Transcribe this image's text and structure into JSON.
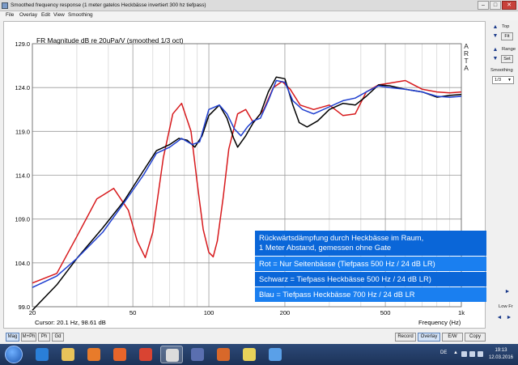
{
  "window": {
    "title": "Smoothed frequency response (1 meter gatelos Heckbässe invertiert 300 hz tiefpass)",
    "minimize": "–",
    "maximize": "□",
    "close": "✕"
  },
  "menu": [
    "File",
    "Overlay",
    "Edit",
    "View",
    "Smoothing"
  ],
  "chart_data": {
    "type": "line",
    "title": "FR Magnitude dB re 20uPa/V (smoothed 1/3 oct)",
    "xlabel": "Frequency (Hz)",
    "ylabel": "",
    "xscale": "log",
    "xlim": [
      20,
      1000
    ],
    "ylim": [
      99,
      129
    ],
    "x_ticks": [
      20,
      50,
      100,
      200,
      500,
      1000
    ],
    "x_tick_labels": [
      "20",
      "50",
      "100",
      "200",
      "500",
      "1k"
    ],
    "y_ticks": [
      99,
      104,
      109,
      114,
      119,
      124,
      129
    ],
    "y_tick_labels": [
      "99.0",
      "104.0",
      "109.0",
      "114.0",
      "119.0",
      "124.0",
      "129.0"
    ],
    "grid": true,
    "cursor_text": "Cursor: 20.1 Hz, 98.61 dB",
    "watermark": [
      "A",
      "R",
      "T",
      "A"
    ],
    "series": [
      {
        "color": "#d7191c",
        "points": [
          [
            20,
            101.7
          ],
          [
            25,
            102.8
          ],
          [
            30,
            107.0
          ],
          [
            36,
            111.3
          ],
          [
            42,
            112.5
          ],
          [
            48,
            110.0
          ],
          [
            52,
            106.5
          ],
          [
            56,
            104.6
          ],
          [
            60,
            107.5
          ],
          [
            66,
            116.0
          ],
          [
            72,
            121.0
          ],
          [
            78,
            122.2
          ],
          [
            85,
            119.0
          ],
          [
            90,
            113.0
          ],
          [
            95,
            107.8
          ],
          [
            100,
            105.2
          ],
          [
            104,
            104.7
          ],
          [
            108,
            106.5
          ],
          [
            114,
            111.5
          ],
          [
            120,
            117.0
          ],
          [
            130,
            121.0
          ],
          [
            140,
            121.5
          ],
          [
            150,
            120.0
          ],
          [
            165,
            121.5
          ],
          [
            180,
            124.0
          ],
          [
            195,
            124.7
          ],
          [
            210,
            123.8
          ],
          [
            230,
            122.0
          ],
          [
            260,
            121.5
          ],
          [
            300,
            122.0
          ],
          [
            340,
            120.8
          ],
          [
            380,
            121.0
          ],
          [
            420,
            123.5
          ],
          [
            470,
            124.3
          ],
          [
            520,
            124.5
          ],
          [
            600,
            124.8
          ],
          [
            700,
            123.8
          ],
          [
            800,
            123.5
          ],
          [
            900,
            123.4
          ],
          [
            1000,
            123.5
          ]
        ]
      },
      {
        "color": "#000000",
        "points": [
          [
            20,
            98.6
          ],
          [
            25,
            101.5
          ],
          [
            30,
            104.5
          ],
          [
            38,
            108.0
          ],
          [
            46,
            111.0
          ],
          [
            55,
            114.5
          ],
          [
            62,
            116.8
          ],
          [
            70,
            117.5
          ],
          [
            76,
            118.2
          ],
          [
            82,
            118.0
          ],
          [
            88,
            117.2
          ],
          [
            94,
            118.5
          ],
          [
            100,
            120.8
          ],
          [
            110,
            122.0
          ],
          [
            118,
            120.5
          ],
          [
            125,
            118.3
          ],
          [
            130,
            117.2
          ],
          [
            140,
            118.5
          ],
          [
            150,
            120.0
          ],
          [
            160,
            121.0
          ],
          [
            172,
            123.5
          ],
          [
            185,
            125.2
          ],
          [
            200,
            125.0
          ],
          [
            215,
            122.0
          ],
          [
            228,
            120.0
          ],
          [
            245,
            119.5
          ],
          [
            270,
            120.2
          ],
          [
            300,
            121.5
          ],
          [
            340,
            122.2
          ],
          [
            380,
            122.0
          ],
          [
            420,
            123.0
          ],
          [
            470,
            124.3
          ],
          [
            520,
            124.2
          ],
          [
            600,
            123.8
          ],
          [
            700,
            123.5
          ],
          [
            800,
            122.9
          ],
          [
            900,
            123.1
          ],
          [
            1000,
            123.2
          ]
        ]
      },
      {
        "color": "#1f3fd0",
        "points": [
          [
            20,
            101.2
          ],
          [
            25,
            102.5
          ],
          [
            30,
            104.5
          ],
          [
            38,
            107.5
          ],
          [
            46,
            110.8
          ],
          [
            55,
            114.0
          ],
          [
            62,
            116.5
          ],
          [
            70,
            117.2
          ],
          [
            78,
            118.2
          ],
          [
            86,
            117.5
          ],
          [
            92,
            117.8
          ],
          [
            100,
            121.5
          ],
          [
            110,
            122.0
          ],
          [
            118,
            121.0
          ],
          [
            126,
            119.3
          ],
          [
            134,
            118.5
          ],
          [
            142,
            119.5
          ],
          [
            150,
            120.2
          ],
          [
            160,
            120.5
          ],
          [
            172,
            122.5
          ],
          [
            185,
            124.8
          ],
          [
            200,
            124.6
          ],
          [
            215,
            122.5
          ],
          [
            235,
            121.5
          ],
          [
            260,
            121.0
          ],
          [
            300,
            121.8
          ],
          [
            340,
            122.5
          ],
          [
            380,
            122.8
          ],
          [
            420,
            123.5
          ],
          [
            470,
            124.2
          ],
          [
            520,
            124.0
          ],
          [
            600,
            123.8
          ],
          [
            700,
            123.5
          ],
          [
            800,
            123.0
          ],
          [
            900,
            122.9
          ],
          [
            1000,
            123.0
          ]
        ]
      }
    ],
    "legend_lines": [
      {
        "text": "Rückwärtsdämpfung durch Heckbässe im Raum,",
        "color": "#0a66d8"
      },
      {
        "text": "1 Meter Abstand, gemessen ohne Gate",
        "color": "#0a66d8"
      },
      {
        "text": "Rot = Nur Seitenbässe (Tiefpass 500 Hz / 24 dB LR)",
        "color": "#1a7ff0"
      },
      {
        "text": "Schwarz = Tiefpass Heckbässe 500 Hz / 24 dB LR)",
        "color": "#0a66d8"
      },
      {
        "text": "Blau = Tiefpass Heckbässe 700 Hz / 24 dB LR",
        "color": "#1a7ff0"
      }
    ]
  },
  "side_panel": {
    "top_label": "Top",
    "fit_button": "Fit",
    "range_label": "Range",
    "set_button": "Set",
    "smoothing_label": "Smoothing",
    "smoothing_value": "1/3",
    "up_arrow": "▲",
    "down_arrow": "▼",
    "low_fr_label": "Low Fr"
  },
  "bottom_bar": {
    "left_buttons": [
      "Mag",
      "M+Ph",
      "Ph",
      "Gd"
    ],
    "active_left": "Mag",
    "right_buttons": [
      "Record",
      "Overlay",
      "E/W",
      "Copy"
    ],
    "active_right": "Overlay"
  },
  "taskbar": {
    "apps": [
      {
        "name": "ie-icon",
        "color": "#2a7fd8"
      },
      {
        "name": "folder-icon",
        "color": "#e8c35a"
      },
      {
        "name": "media-player-icon",
        "color": "#e87b2a"
      },
      {
        "name": "firefox-icon",
        "color": "#e8652a"
      },
      {
        "name": "chrome-icon",
        "color": "#d94432"
      },
      {
        "name": "ohm-app-icon",
        "color": "#dcdcdc"
      },
      {
        "name": "audio-app-icon",
        "color": "#5a6fb0"
      },
      {
        "name": "office-icon",
        "color": "#d8682a"
      },
      {
        "name": "text-editor-icon",
        "color": "#e8d35a"
      },
      {
        "name": "windows-app-icon",
        "color": "#5aa0e8"
      }
    ],
    "language": "DE",
    "time": "19:13",
    "date": "12.03.2016"
  }
}
